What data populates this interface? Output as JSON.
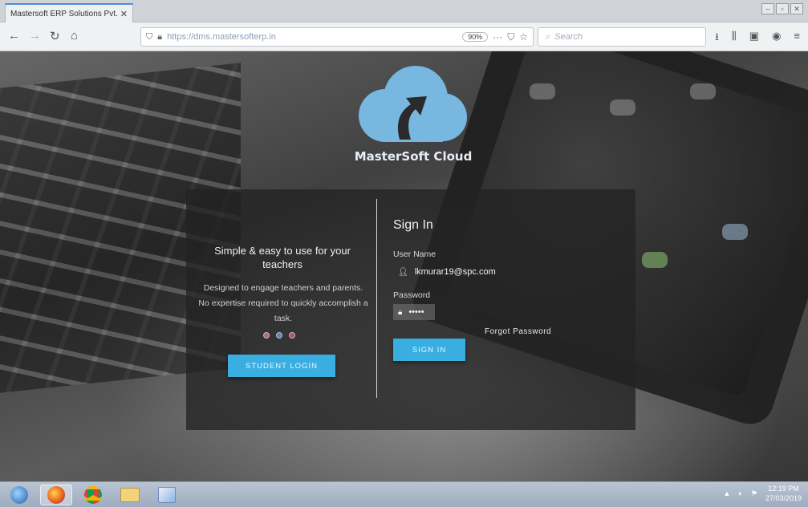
{
  "browser": {
    "tab_title": "Mastersoft ERP Solutions Pvt.l",
    "tab_close": "✕",
    "url": "https://dms.mastersofterp.in",
    "zoom": "90%",
    "search_placeholder": "Search"
  },
  "logo": {
    "text": "MasterSoft Cloud",
    "color": "#78b7e0"
  },
  "left_panel": {
    "tagline": "Simple & easy to use for your teachers",
    "description": "Designed to engage teachers and parents. No expertise required to quickly accomplish a task.",
    "student_login_label": "STUDENT LOGIN"
  },
  "signin": {
    "title": "Sign In",
    "username_label": "User Name",
    "username_value": "lkmurar19@spc.com",
    "password_label": "Password",
    "password_value": "•••••",
    "forgot_label": "Forgot Password",
    "signin_button": "SIGN IN"
  },
  "colors": {
    "accent": "#3aaee0"
  },
  "taskbar": {
    "time": "12:19 PM",
    "date": "27/03/2019"
  }
}
